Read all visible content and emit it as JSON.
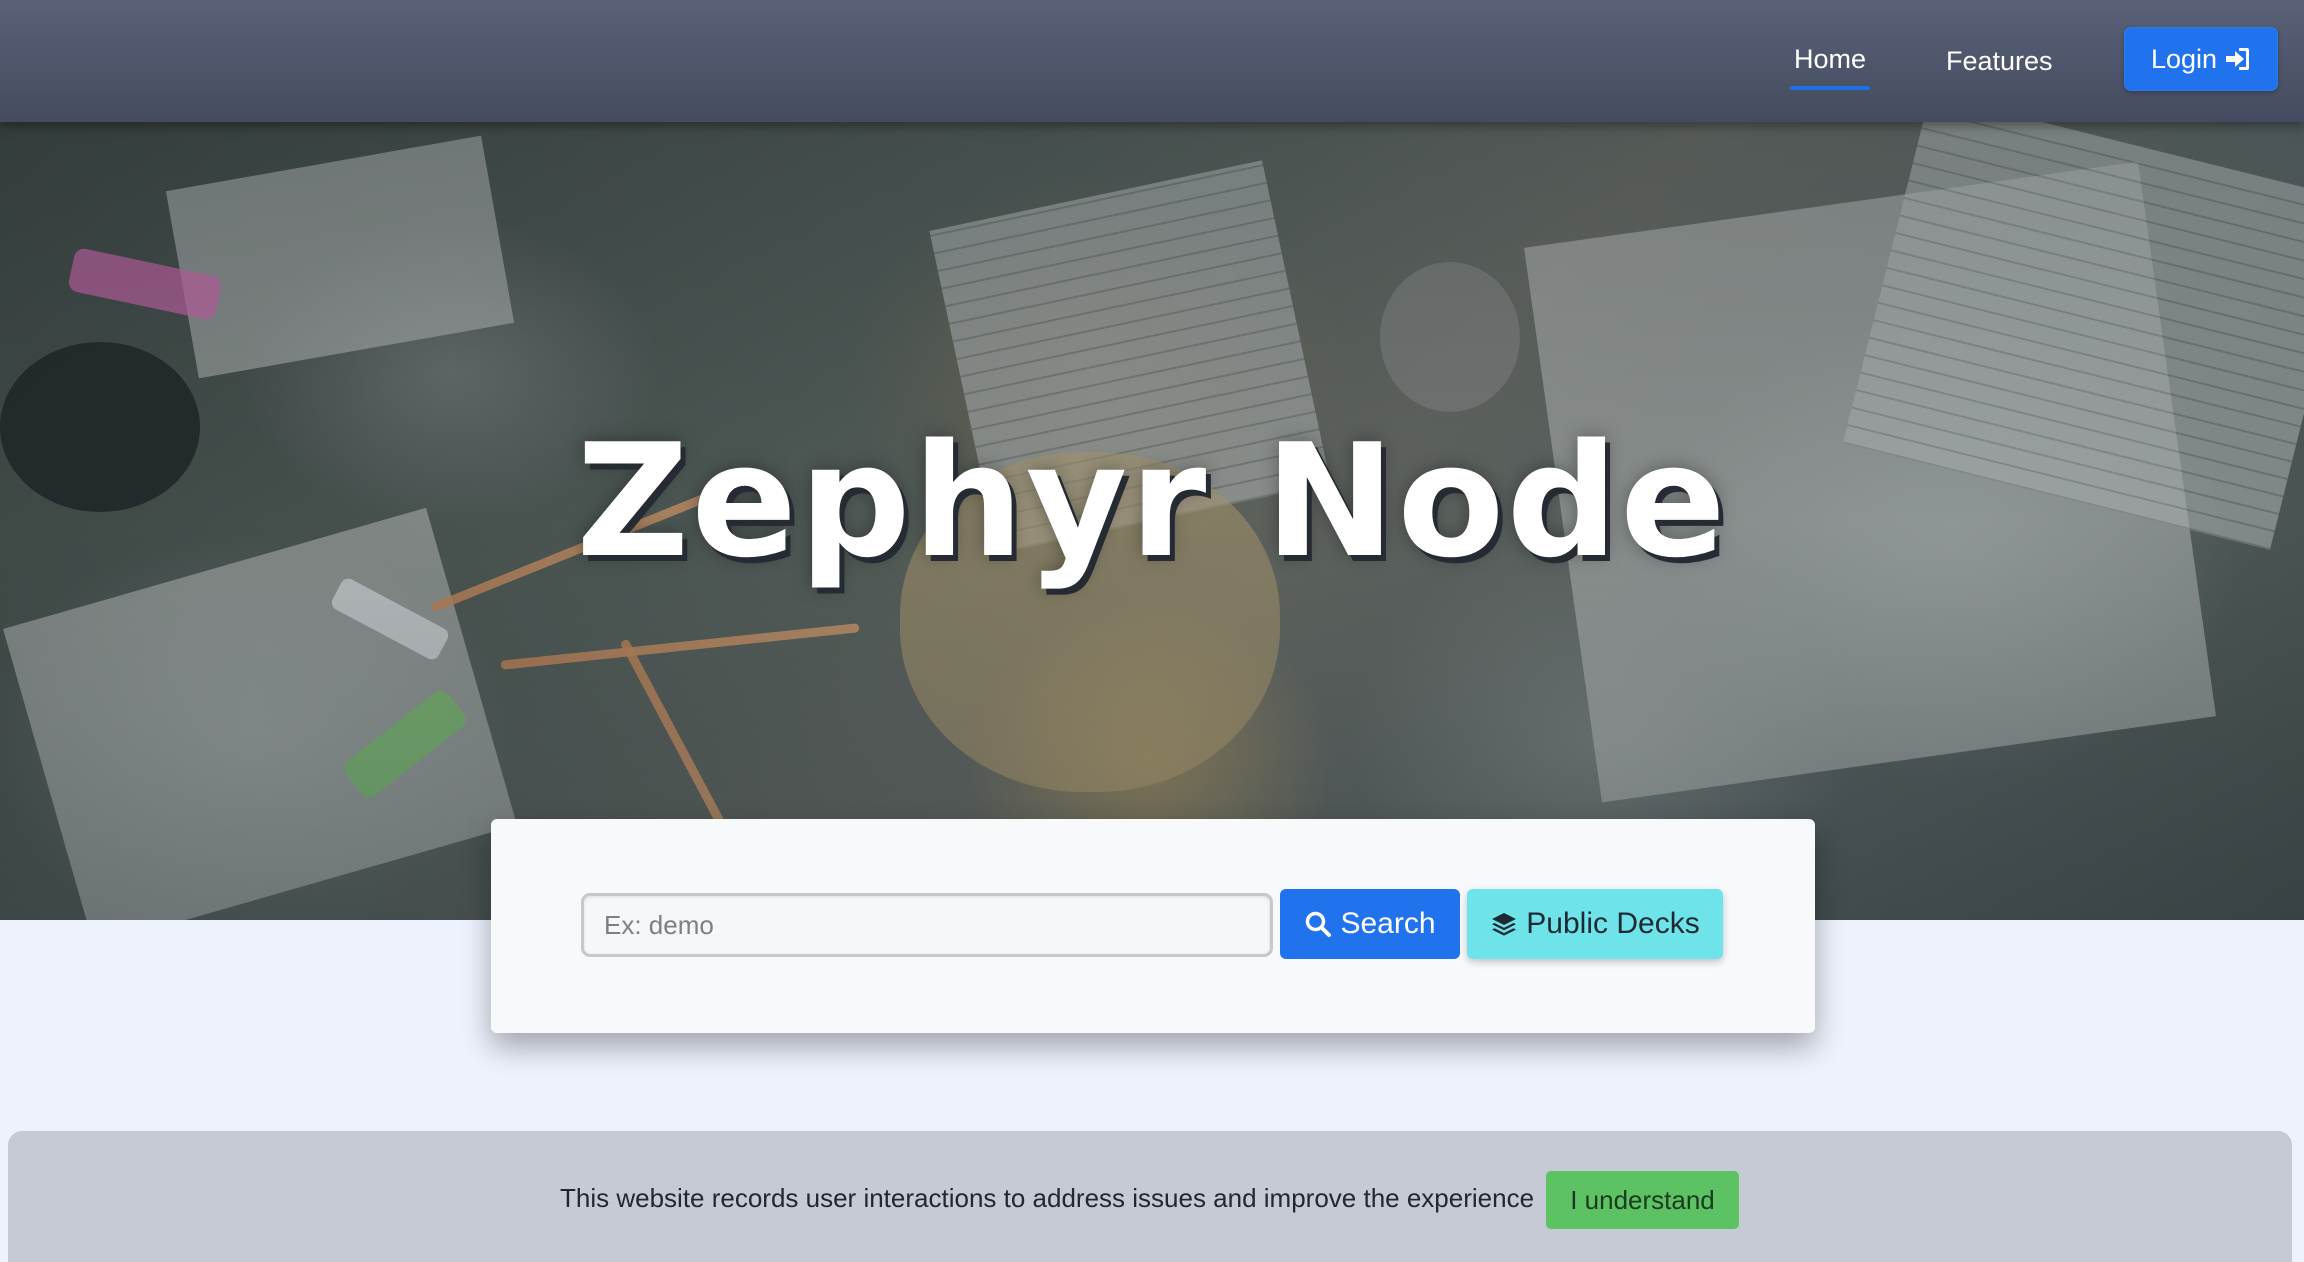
{
  "nav": {
    "home_label": "Home",
    "features_label": "Features",
    "login_label": "Login",
    "login_icon": "sign-in-icon",
    "accent_color": "#2172ed"
  },
  "hero": {
    "title": "Zephyr Node"
  },
  "search": {
    "placeholder": "Ex: demo",
    "value": "",
    "search_label": "Search",
    "search_icon": "search-icon",
    "public_decks_label": "Public Decks",
    "public_decks_icon": "layers-icon",
    "public_decks_color": "#6ee3ea"
  },
  "consent": {
    "message": "This website records user interactions to address issues and improve the experience",
    "accept_label": "I understand",
    "accept_color": "#5cc264"
  }
}
